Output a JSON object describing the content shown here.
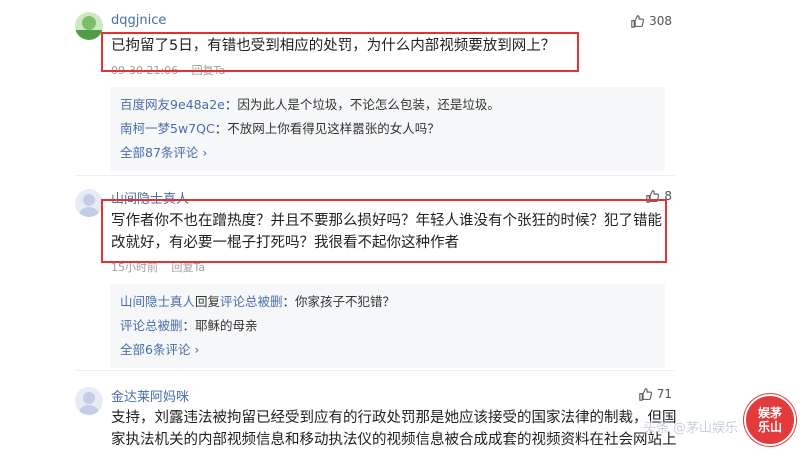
{
  "comments": [
    {
      "username": "dqgjnice",
      "likes": "308",
      "text": "已拘留了5日，有错也受到相应的处罚，为什么内部视频要放到网上？",
      "time": "09-30 21:06",
      "reply_label": "回复Ta",
      "replies": [
        {
          "name": "百度网友9e48a2e",
          "text": "：因为此人是个垃圾，不论怎么包装，还是垃圾。"
        },
        {
          "name": "南柯一梦5w7QC",
          "text": "：不放网上你看得见这样嚣张的女人吗？"
        }
      ],
      "all_replies": "全部87条评论 ›"
    },
    {
      "username": "山间隐士真人",
      "likes": "8",
      "text": "写作者你不也在蹭热度？并且不要那么损好吗？年轻人谁没有个张狂的时候？犯了错能改就好，有必要一棍子打死吗？我很看不起你这种作者",
      "time": "15小时前",
      "reply_label": "回复Ta",
      "replies": [
        {
          "name": "山间隐士真人",
          "mid": "回复",
          "name2": "评论总被删",
          "text": "：你家孩子不犯错？"
        },
        {
          "name": "评论总被删",
          "text": "：耶稣的母亲"
        }
      ],
      "all_replies": "全部6条评论 ›"
    },
    {
      "username": "金达莱阿妈咪",
      "likes": "71",
      "text": "支持，刘露违法被拘留已经受到应有的行政处罚那是她应该接受的国家法律的制裁，但国家执法机关的内部视频信息和移动执法仪的视频信息被合成成套的视频资料在社会网站上"
    }
  ],
  "watermark": {
    "text": "头条 @茅山娱乐",
    "seal_line1": "娱茅",
    "seal_line2": "乐山"
  },
  "colors": {
    "highlight": "#e23232",
    "link": "#4a6ea9"
  }
}
